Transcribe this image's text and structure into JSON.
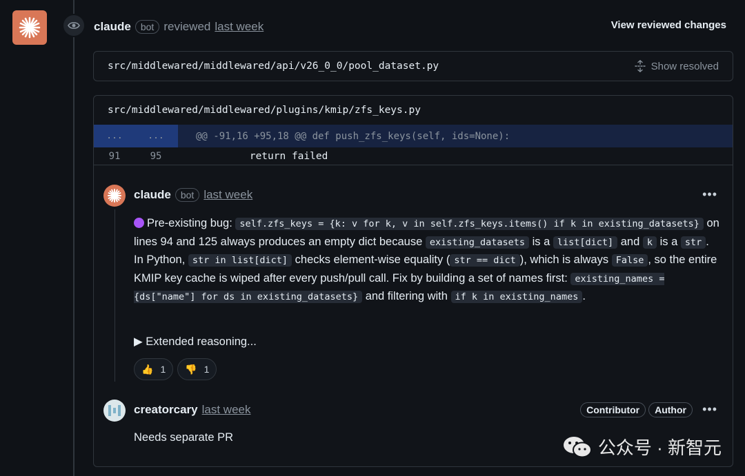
{
  "review": {
    "author": "claude",
    "bot_badge": "bot",
    "action": "reviewed",
    "time": "last week",
    "view_changes": "View reviewed changes"
  },
  "files": [
    {
      "path": "src/middlewared/middlewared/api/v26_0_0/pool_dataset.py",
      "show_resolved": "Show resolved"
    },
    {
      "path": "src/middlewared/middlewared/plugins/kmip/zfs_keys.py",
      "hunk": {
        "left": "...",
        "right": "...",
        "text": "@@ -91,16 +95,18 @@ def push_zfs_keys(self, ids=None):"
      },
      "line": {
        "old": "91",
        "new": "95",
        "code": "        return failed"
      }
    }
  ],
  "comments": [
    {
      "author": "claude",
      "badge": "bot",
      "time": "last week",
      "menu": "•••",
      "body": {
        "t1": "Pre-existing bug: ",
        "c1": "self.zfs_keys = {k: v for k, v in self.zfs_keys.items() if k in existing_datasets}",
        "t2": " on lines 94 and 125 always produces an empty dict because ",
        "c2": "existing_datasets",
        "t3": " is a ",
        "c3": "list[dict]",
        "t4": " and ",
        "c4": "k",
        "t5": " is a ",
        "c5": "str",
        "t6": ". In Python, ",
        "c6": "str in list[dict]",
        "t7": " checks element-wise equality (",
        "c7": "str == dict",
        "t8": "), which is always ",
        "c8": "False",
        "t9": ", so the entire KMIP key cache is wiped after every push/pull call. Fix by building a set of names first: ",
        "c9": "existing_names = {ds[\"name\"] for ds in existing_datasets}",
        "t10": " and filtering with ",
        "c10": "if k in existing_names",
        "t11": "."
      },
      "extended": "▶ Extended reasoning...",
      "reactions": [
        {
          "emoji": "👍",
          "count": "1"
        },
        {
          "emoji": "👎",
          "count": "1"
        }
      ]
    },
    {
      "author": "creatorcary",
      "time": "last week",
      "roles": [
        "Contributor",
        "Author"
      ],
      "menu": "•••",
      "body": "Needs separate PR"
    }
  ],
  "watermark": {
    "text": "公众号 · 新智元"
  },
  "colors": {
    "accent": "#d97757",
    "background": "#0f1217",
    "hunk": "#172341"
  }
}
